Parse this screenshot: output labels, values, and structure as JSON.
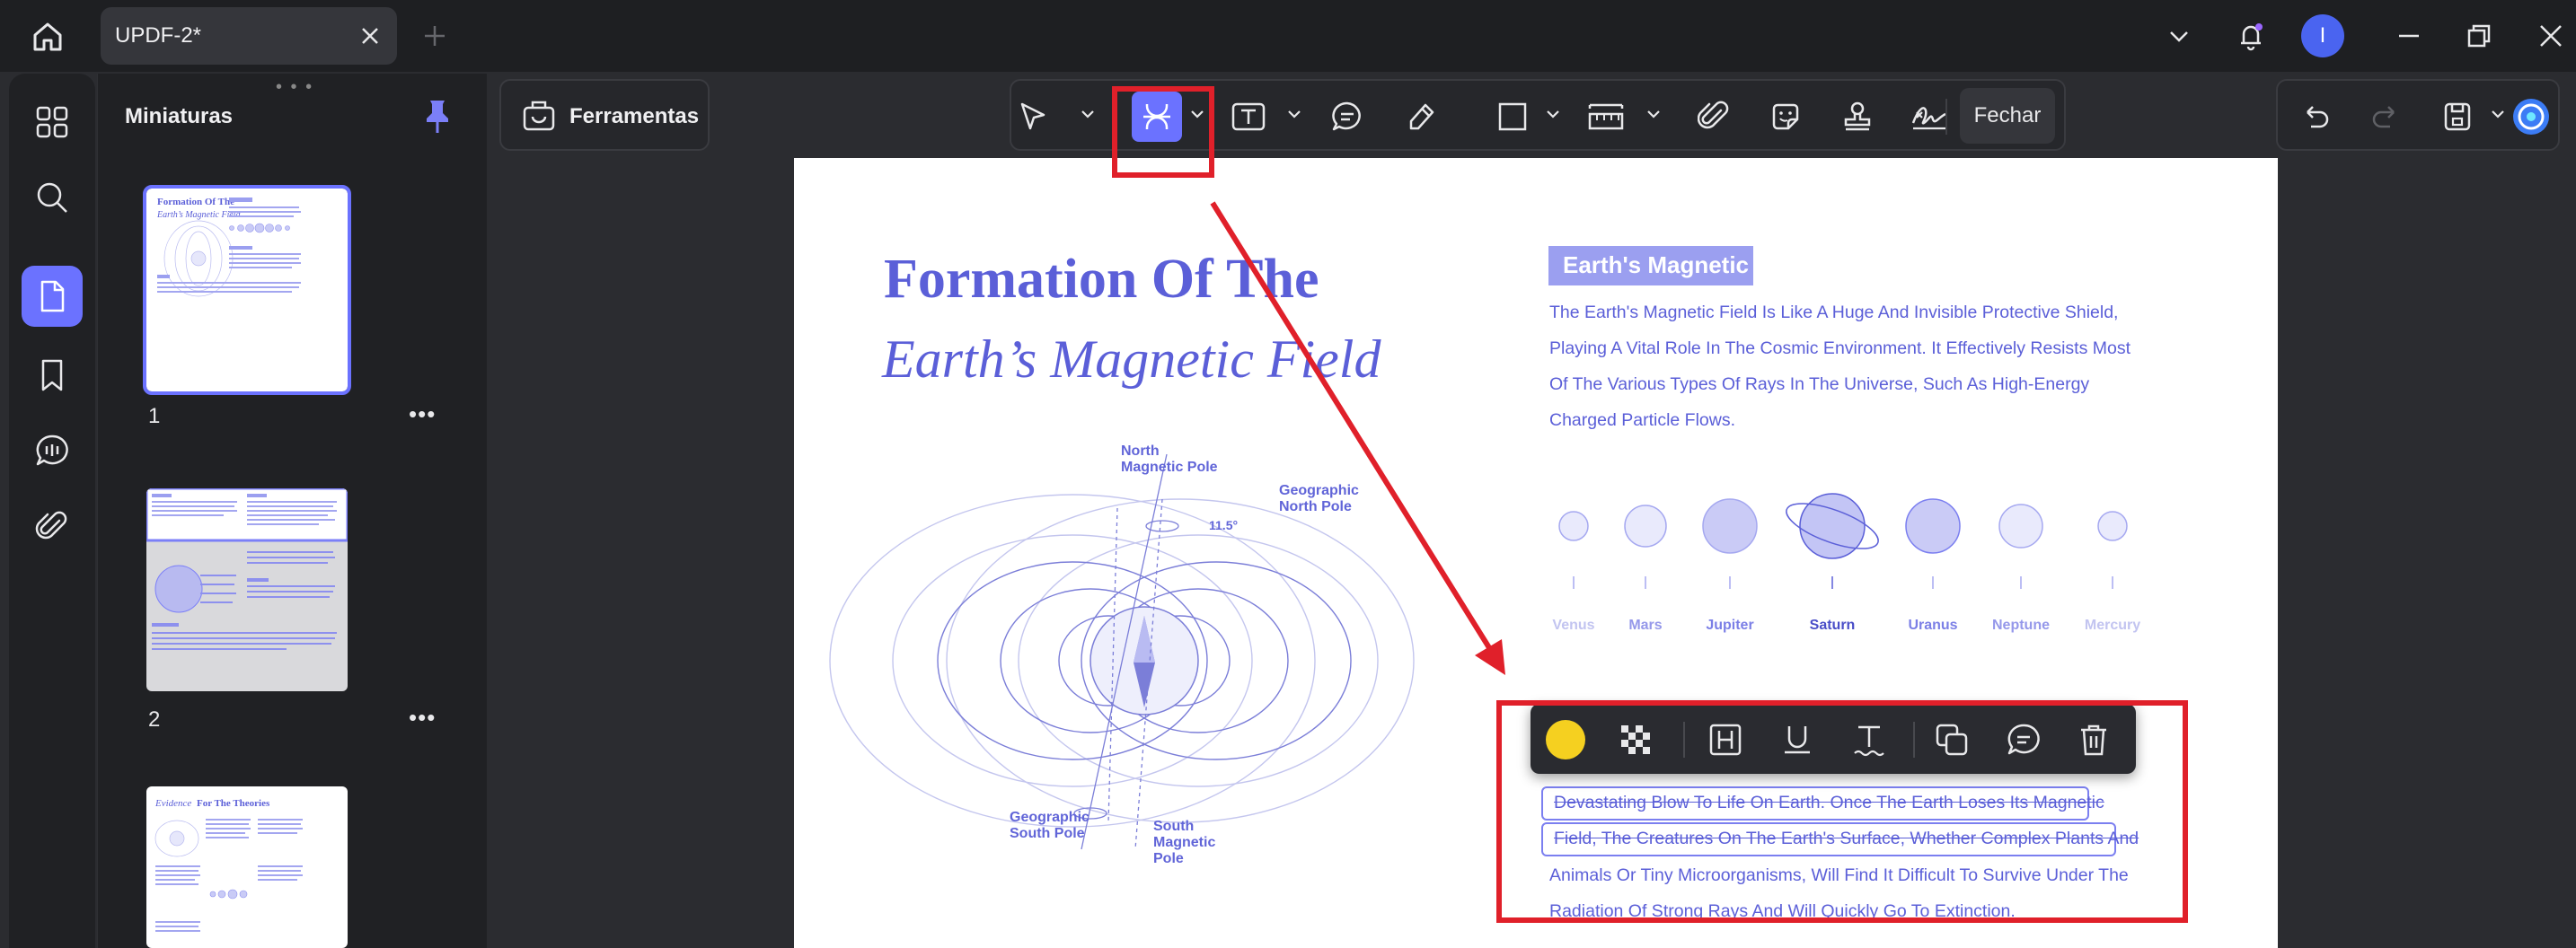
{
  "titlebar": {
    "tab_title": "UPDF-2*",
    "avatar_letter": "I"
  },
  "thumbnails": {
    "title": "Miniaturas",
    "grip": "• • •",
    "items": [
      {
        "number": "1",
        "more": "•••"
      },
      {
        "number": "2",
        "more": "•••"
      }
    ]
  },
  "toolbar": {
    "tools_label": "Ferramentas",
    "close_label": "Fechar"
  },
  "page": {
    "title_line1": "Formation Of The",
    "title_line2": "Earth’s Magnetic Field",
    "badge": "Earth's Magnetic",
    "intro_lines": [
      "The Earth's Magnetic Field Is Like A Huge And Invisible Protective Shield,",
      "Playing A Vital Role In The Cosmic Environment. It Effectively Resists Most",
      "Of The Various Types Of Rays In The Universe, Such As High-Energy",
      "Charged Particle Flows."
    ],
    "planets": [
      "Venus",
      "Mars",
      "Jupiter",
      "Saturn",
      "Uranus",
      "Neptune",
      "Mercury"
    ],
    "diagram_labels": {
      "north_magnetic": "North\nMagnetic Pole",
      "geo_north": "Geographic\nNorth Pole",
      "angle": "11.5°",
      "geo_south": "Geographic\nSouth Pole",
      "south_magnetic": "South\nMagnetic\nPole"
    },
    "selected_lines": [
      "Devastating Blow To Life On Earth. Once The Earth Loses Its Magnetic",
      "Field, The Creatures On The Earth's Surface, Whether Complex Plants And"
    ],
    "other_lines": [
      "Animals Or Tiny Microorganisms, Will Find It Difficult To Survive Under The",
      "Radiation Of Strong Rays And Will Quickly Go To Extinction."
    ]
  },
  "thumb1": {
    "title_a": "Formation Of The",
    "title_b": "Earth’s Magnetic Field"
  },
  "thumb3": {
    "title_a": "Evidence",
    "title_b": "For The Theories"
  },
  "colors": {
    "accent": "#6b72ff",
    "highlight_yellow": "#f5d020",
    "annotation_red": "#e0202a",
    "page_text": "#5b5fd8"
  }
}
